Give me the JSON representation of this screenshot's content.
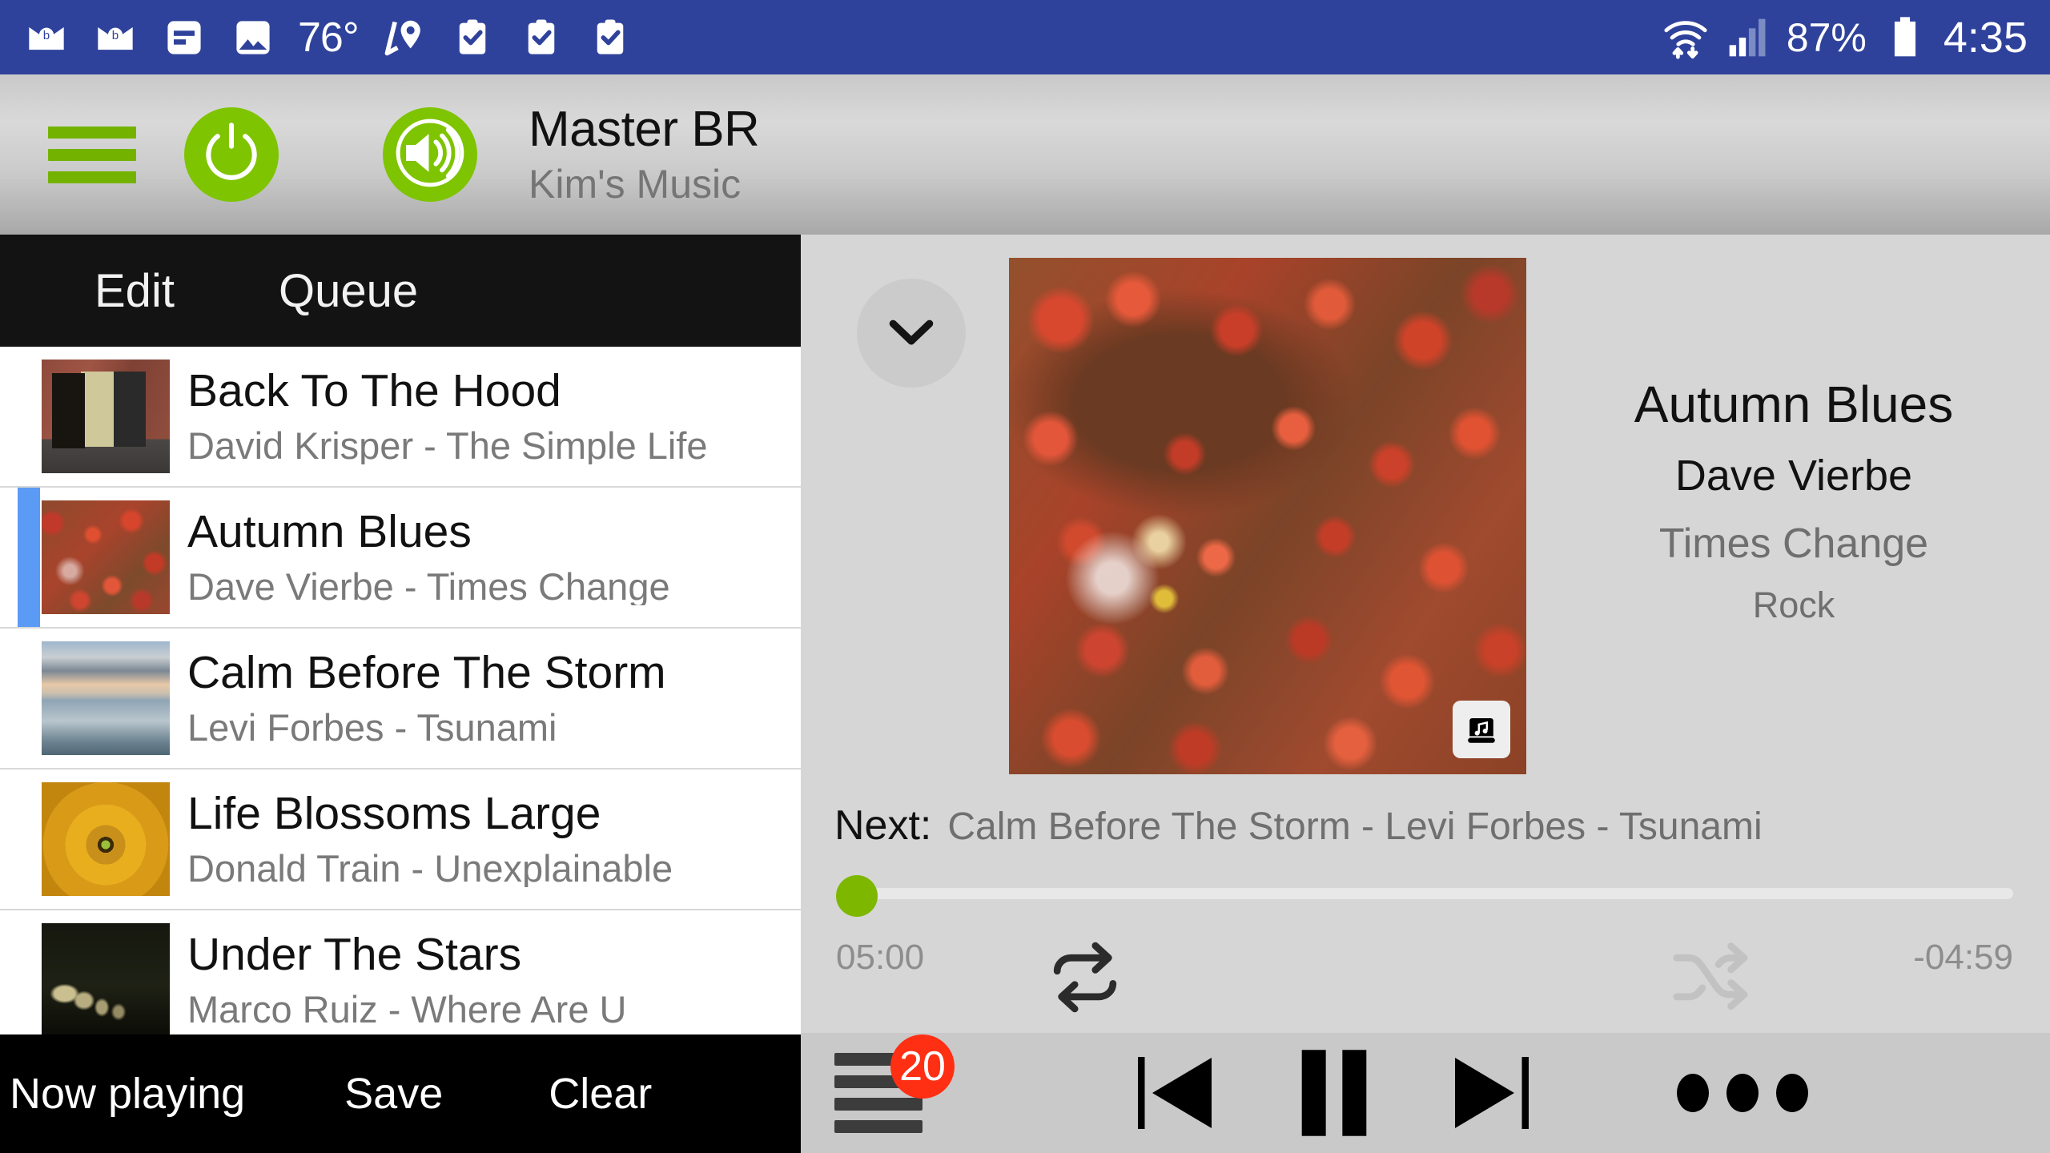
{
  "statusbar": {
    "left_icons": [
      "mail-icon",
      "mail-icon",
      "message-icon",
      "photo-icon",
      "temperature-label",
      "location-icon",
      "task-icon",
      "task-checked-icon",
      "task-checked-icon"
    ],
    "temperature": "76°",
    "wifi_icon": "wifi-icon",
    "signal_icon": "cell-signal-icon",
    "battery_percent": "87%",
    "battery_icon": "battery-icon",
    "time": "4:35",
    "background_color": "#2f429b"
  },
  "header": {
    "menu_icon": "hamburger-icon",
    "power_icon": "power-icon",
    "volume_icon": "volume-icon",
    "zone_name": "Master BR",
    "source_name": "Kim's Music",
    "accent_color": "#7ec400"
  },
  "left_panel": {
    "tabs": [
      {
        "label": "Edit"
      },
      {
        "label": "Queue"
      }
    ],
    "tracks": [
      {
        "title": "Back To The Hood",
        "subtitle": "David Krisper - The Simple Life",
        "art": "art-hood",
        "selected": false
      },
      {
        "title": "Autumn Blues",
        "subtitle": "Dave Vierbe - Times Change",
        "art": "art-autumn",
        "selected": true
      },
      {
        "title": "Calm Before The Storm",
        "subtitle": "Levi Forbes - Tsunami",
        "art": "art-storm",
        "selected": false
      },
      {
        "title": "Life Blossoms Large",
        "subtitle": "Donald Train - Unexplainable",
        "art": "art-flower",
        "selected": false
      },
      {
        "title": "Under The Stars",
        "subtitle": "Marco Ruiz - Where Are U",
        "art": "art-stars",
        "selected": false
      }
    ],
    "bottom_tabs": [
      {
        "label": "Now playing"
      },
      {
        "label": "Save"
      },
      {
        "label": "Clear"
      }
    ]
  },
  "right_panel": {
    "collapse_icon": "chevron-down-icon",
    "album_art_badge_icon": "music-note-icon",
    "now_playing": {
      "title": "Autumn Blues",
      "artist": "Dave Vierbe",
      "album": "Times Change",
      "genre": "Rock"
    },
    "next_label": "Next:",
    "next_value": "Calm Before The Storm - Levi Forbes - Tsunami",
    "seek": {
      "elapsed": "05:00",
      "remaining": "-04:59",
      "progress_percent": 0,
      "thumb_color": "#7db700"
    },
    "repeat_icon": "repeat-icon",
    "repeat_active": true,
    "shuffle_icon": "shuffle-icon",
    "shuffle_active": false,
    "controls": {
      "queue_icon": "queue-list-icon",
      "queue_count": "20",
      "queue_badge_color": "#ff2f14",
      "previous_icon": "skip-previous-icon",
      "pause_icon": "pause-icon",
      "next_icon": "skip-next-icon",
      "more_icon": "more-horizontal-icon"
    }
  }
}
